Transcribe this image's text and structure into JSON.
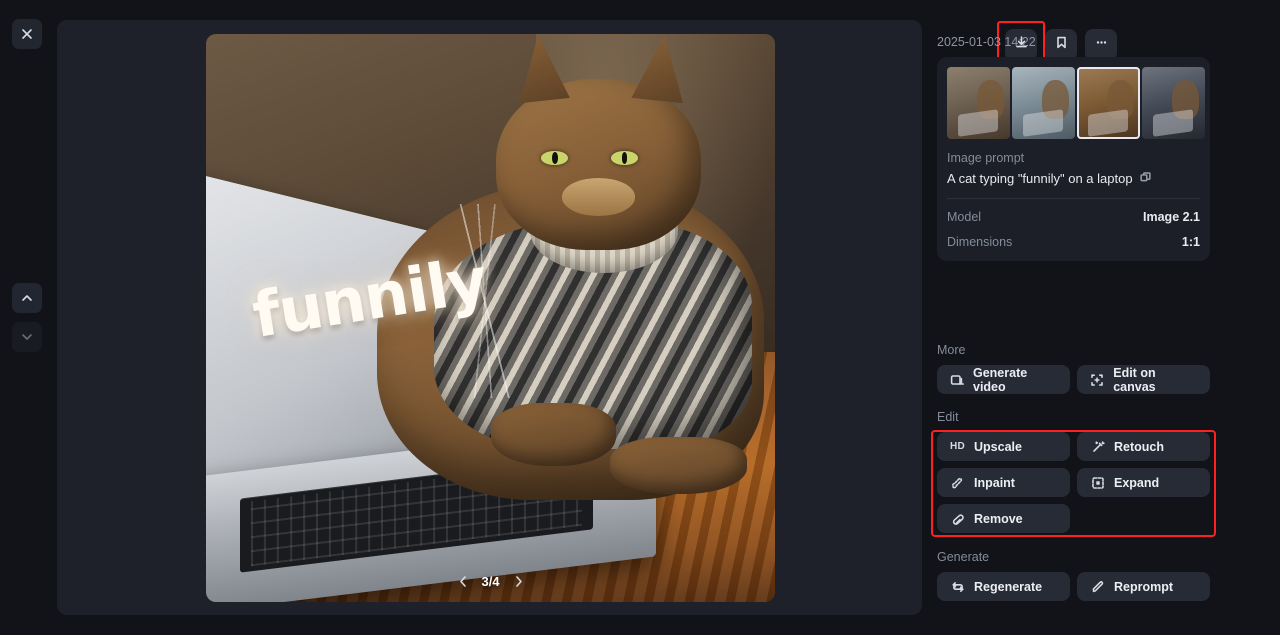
{
  "left_rail": {
    "close_icon": "close-icon",
    "prev_icon": "chevron-up-icon",
    "next_icon": "chevron-down-icon"
  },
  "viewer": {
    "image_alt": "A cat in a knitted sweater typing on a laptop",
    "overlay_word": "funnily",
    "pager": {
      "prev_icon": "chevron-left-icon",
      "label": "3/4",
      "next_icon": "chevron-right-icon",
      "current": 3,
      "total": 4
    }
  },
  "sidebar": {
    "toolbar": {
      "download_label": "download-icon",
      "bookmark_label": "bookmark-icon",
      "more_label": "more-options-icon"
    },
    "timestamp": "2025-01-03 14:22",
    "thumbnails": [
      {
        "name": "thumbnail-1",
        "selected": false
      },
      {
        "name": "thumbnail-2",
        "selected": false
      },
      {
        "name": "thumbnail-3",
        "selected": true
      },
      {
        "name": "thumbnail-4",
        "selected": false
      }
    ],
    "prompt_label": "Image prompt",
    "prompt_text": "A cat typing \"funnily\" on a laptop",
    "copy_icon": "copy-icon",
    "meta": [
      {
        "key": "Model",
        "value": "Image 2.1"
      },
      {
        "key": "Dimensions",
        "value": "1:1"
      }
    ],
    "sections": [
      {
        "title": "More",
        "actions": [
          {
            "label": "Generate video",
            "icon": "video-frame-icon"
          },
          {
            "label": "Edit on canvas",
            "icon": "canvas-crop-icon"
          }
        ]
      },
      {
        "title": "Edit",
        "highlighted": true,
        "actions": [
          {
            "label": "Upscale",
            "icon": "hd-icon"
          },
          {
            "label": "Retouch",
            "icon": "magic-wand-icon"
          },
          {
            "label": "Inpaint",
            "icon": "paint-brush-icon"
          },
          {
            "label": "Expand",
            "icon": "expand-frame-icon"
          },
          {
            "label": "Remove",
            "icon": "eraser-icon"
          }
        ]
      },
      {
        "title": "Generate",
        "actions": [
          {
            "label": "Regenerate",
            "icon": "refresh-icon"
          },
          {
            "label": "Reprompt",
            "icon": "pencil-icon"
          }
        ]
      }
    ]
  },
  "colors": {
    "page_bg": "#111318",
    "panel_bg": "#1e2129",
    "card_bg": "#1c1f27",
    "button_bg": "#272b35",
    "text_primary": "#e7eaf0",
    "text_muted": "#848b9a",
    "annotation": "#ff2020"
  }
}
